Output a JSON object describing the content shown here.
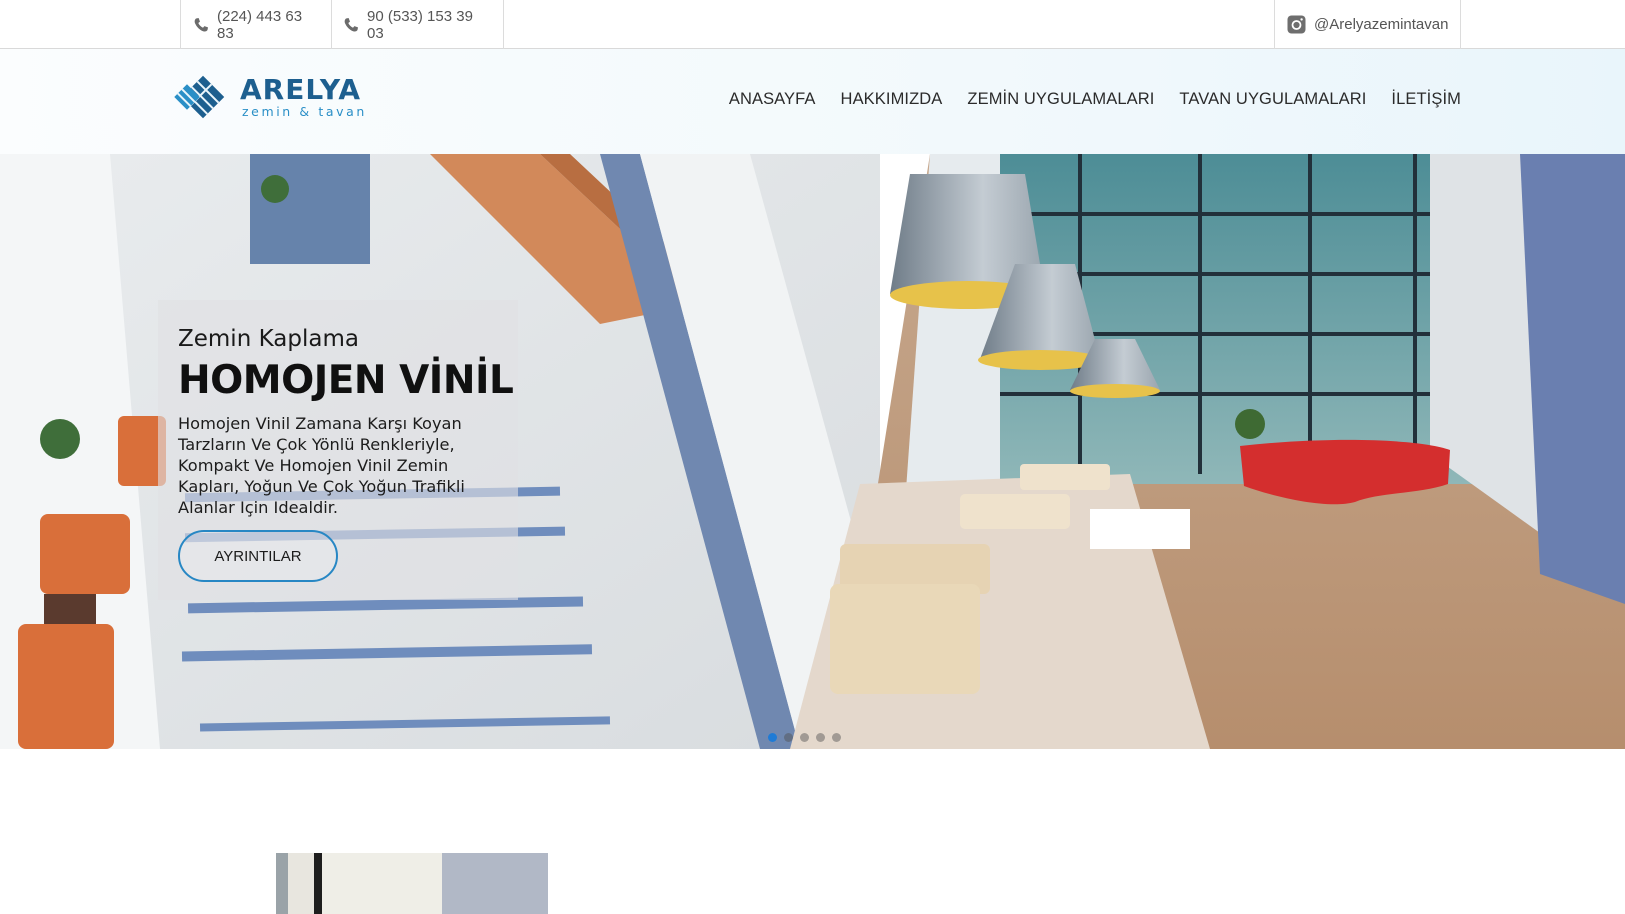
{
  "topbar": {
    "phone_1": "(224) 443 63 83",
    "phone_2": "90 (533) 153 39 03",
    "instagram": "@Arelyazemintavan",
    "icons": [
      "phone-icon",
      "phone-icon",
      "instagram-icon"
    ]
  },
  "logo": {
    "name": "ARELYA",
    "tagline": "zemin & tavan"
  },
  "nav": {
    "items": [
      {
        "label": "ANASAYFA"
      },
      {
        "label": "HAKKIMIZDA"
      },
      {
        "label": "ZEMİN UYGULAMALARI"
      },
      {
        "label": "TAVAN UYGULAMALARI"
      },
      {
        "label": "İLETİŞİM"
      }
    ]
  },
  "hero": {
    "subtitle": "Zemin Kaplama",
    "title": "HOMOJEN VİNİL",
    "text": "Homojen Vinil Zamana Karşı Koyan Tarzların Ve Çok Yönlü Renkleriyle, Kompakt Ve Homojen Vinil Zemin Kapları, Yoğun Ve Çok Yoğun Trafikli Alanlar Için Idealdir.",
    "button_label": "AYRINTILAR",
    "slide_count": 5,
    "active_slide": 1
  },
  "colors": {
    "accent": "#2787c4",
    "brand": "#1d5f8f",
    "active_dot": "#1f7bd6"
  }
}
